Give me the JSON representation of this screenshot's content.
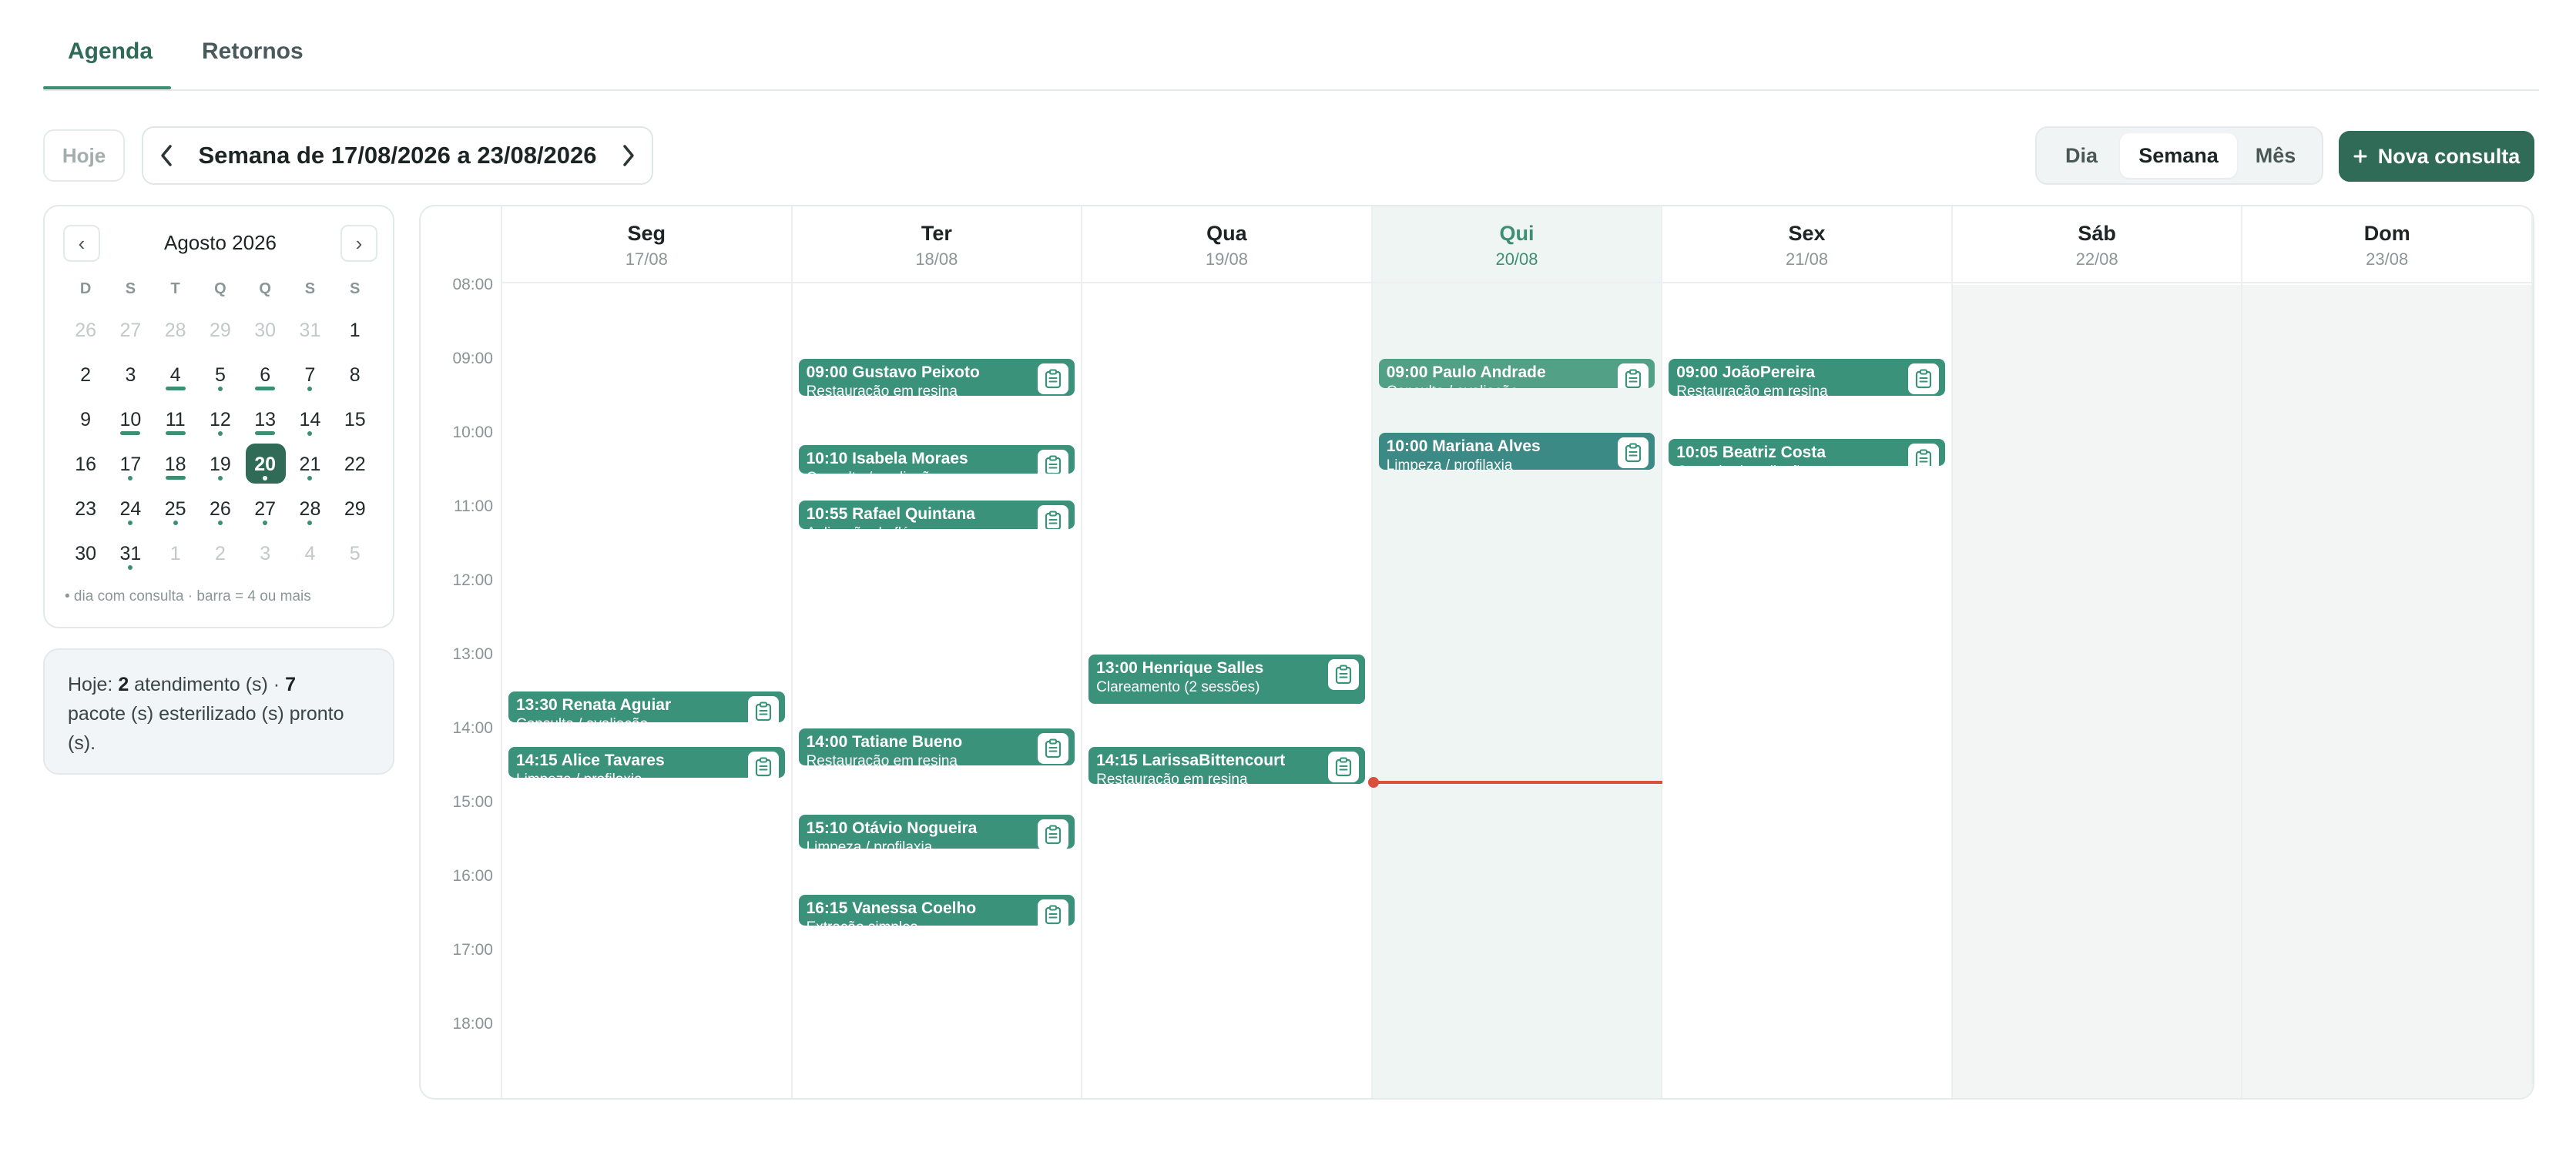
{
  "tabs": [
    {
      "label": "Agenda",
      "active": true
    },
    {
      "label": "Retornos",
      "active": false
    }
  ],
  "toolbar": {
    "today_label": "Hoje",
    "prev_icon": "chevron-left-icon",
    "next_icon": "chevron-right-icon",
    "week_label": "Semana de 17/08/2026 a 23/08/2026",
    "views": [
      "Dia",
      "Semana",
      "Mês"
    ],
    "active_view": "Semana",
    "new_button": "Nova consulta",
    "new_icon": "plus-icon"
  },
  "mini_calendar": {
    "title": "Agosto 2026",
    "prev": "‹",
    "next": "›",
    "weekdays": [
      "D",
      "S",
      "T",
      "Q",
      "Q",
      "S",
      "S"
    ],
    "weeks": [
      [
        {
          "d": "26",
          "m": true
        },
        {
          "d": "27",
          "m": true
        },
        {
          "d": "28",
          "m": true
        },
        {
          "d": "29",
          "m": true
        },
        {
          "d": "30",
          "m": true
        },
        {
          "d": "31",
          "m": true
        },
        {
          "d": "1"
        }
      ],
      [
        {
          "d": "2"
        },
        {
          "d": "3"
        },
        {
          "d": "4",
          "mark": "bar"
        },
        {
          "d": "5",
          "mark": "dot"
        },
        {
          "d": "6",
          "mark": "bar"
        },
        {
          "d": "7",
          "mark": "dot"
        },
        {
          "d": "8"
        }
      ],
      [
        {
          "d": "9"
        },
        {
          "d": "10",
          "mark": "bar"
        },
        {
          "d": "11",
          "mark": "bar"
        },
        {
          "d": "12",
          "mark": "dot"
        },
        {
          "d": "13",
          "mark": "bar"
        },
        {
          "d": "14",
          "mark": "dot"
        },
        {
          "d": "15"
        }
      ],
      [
        {
          "d": "16"
        },
        {
          "d": "17",
          "mark": "dot"
        },
        {
          "d": "18",
          "mark": "bar"
        },
        {
          "d": "19",
          "mark": "dot"
        },
        {
          "d": "20",
          "mark": "dot",
          "today": true
        },
        {
          "d": "21",
          "mark": "dot"
        },
        {
          "d": "22"
        }
      ],
      [
        {
          "d": "23"
        },
        {
          "d": "24",
          "mark": "dot"
        },
        {
          "d": "25",
          "mark": "dot"
        },
        {
          "d": "26",
          "mark": "dot"
        },
        {
          "d": "27",
          "mark": "dot"
        },
        {
          "d": "28",
          "mark": "dot"
        },
        {
          "d": "29"
        }
      ],
      [
        {
          "d": "30"
        },
        {
          "d": "31",
          "mark": "dot"
        },
        {
          "d": "1",
          "m": true
        },
        {
          "d": "2",
          "m": true
        },
        {
          "d": "3",
          "m": true
        },
        {
          "d": "4",
          "m": true
        },
        {
          "d": "5",
          "m": true
        }
      ]
    ],
    "legend": "• dia com consulta  · barra  = 4 ou mais"
  },
  "summary": {
    "prefix": "Hoje: ",
    "count_appts": "2",
    "appts_text": " atendimento  (s) · ",
    "count_packs": "7",
    "rest": "pacote (s) esterilizado (s) pronto  (s)."
  },
  "hours": [
    "08:00",
    "09:00",
    "10:00",
    "11:00",
    "12:00",
    "13:00",
    "14:00",
    "15:00",
    "16:00",
    "17:00",
    "18:00"
  ],
  "days": [
    {
      "name": "Seg",
      "date": "17/08",
      "today": false,
      "weekend": false,
      "appointments": [
        {
          "title": "13:30 Renata Aguiar",
          "subtitle": "Consulta  / avaliação",
          "start": 13.5,
          "end": 13.92,
          "color": "#3a927a"
        },
        {
          "title": "14:15 Alice Tavares",
          "subtitle": "Limpeza  / profilaxia",
          "start": 14.25,
          "end": 14.67,
          "color": "#3a927a"
        }
      ]
    },
    {
      "name": "Ter",
      "date": "18/08",
      "today": false,
      "weekend": false,
      "appointments": [
        {
          "title": "09:00 Gustavo Peixoto",
          "subtitle": "Restauração em resina",
          "start": 9.0,
          "end": 9.5,
          "color": "#3a927a"
        },
        {
          "title": "10:10 Isabela Moraes",
          "subtitle": "Consulta  / avaliação",
          "start": 10.17,
          "end": 10.55,
          "color": "#3a927a"
        },
        {
          "title": "10:55 Rafael Quintana",
          "subtitle": "Aplicação de flúor",
          "start": 10.92,
          "end": 11.3,
          "color": "#3a927a"
        },
        {
          "title": "14:00 Tatiane Bueno",
          "subtitle": "Restauração em resina",
          "start": 14.0,
          "end": 14.5,
          "color": "#3a927a"
        },
        {
          "title": "15:10 Otávio Nogueira",
          "subtitle": "Limpeza  / profilaxia",
          "start": 15.17,
          "end": 15.62,
          "color": "#3a927a"
        },
        {
          "title": "16:15 Vanessa Coelho",
          "subtitle": "Extração simples",
          "start": 16.25,
          "end": 16.67,
          "color": "#3a927a"
        }
      ]
    },
    {
      "name": "Qua",
      "date": "19/08",
      "today": false,
      "weekend": false,
      "appointments": [
        {
          "title": "13:00 Henrique Salles",
          "subtitle": "Clareamento  (2 sessões)",
          "start": 13.0,
          "end": 13.67,
          "color": "#3a927a"
        },
        {
          "title": "14:15 LarissaBittencourt",
          "subtitle": "Restauração em resina",
          "start": 14.25,
          "end": 14.75,
          "color": "#3a927a"
        }
      ]
    },
    {
      "name": "Qui",
      "date": "20/08",
      "today": true,
      "weekend": false,
      "appointments": [
        {
          "title": "09:00 Paulo Andrade",
          "subtitle": "Consulta  / avaliação",
          "start": 9.0,
          "end": 9.4,
          "color": "#52a085"
        },
        {
          "title": "10:00 Mariana Alves",
          "subtitle": "Limpeza  / profilaxia",
          "start": 10.0,
          "end": 10.5,
          "color": "#3b8a85"
        }
      ]
    },
    {
      "name": "Sex",
      "date": "21/08",
      "today": false,
      "weekend": false,
      "appointments": [
        {
          "title": "09:00 JoãoPereira",
          "subtitle": "Restauração em resina",
          "start": 9.0,
          "end": 9.5,
          "color": "#3a927a"
        },
        {
          "title": "10:05 Beatriz Costa",
          "subtitle": "Consulta  / avaliação",
          "start": 10.08,
          "end": 10.45,
          "color": "#3a927a"
        }
      ]
    },
    {
      "name": "Sáb",
      "date": "22/08",
      "today": false,
      "weekend": true,
      "appointments": []
    },
    {
      "name": "Dom",
      "date": "23/08",
      "today": false,
      "weekend": true,
      "appointments": []
    }
  ],
  "now_time": 14.73,
  "now_color": "#d7513c",
  "appointment_icon": "clipboard-icon"
}
